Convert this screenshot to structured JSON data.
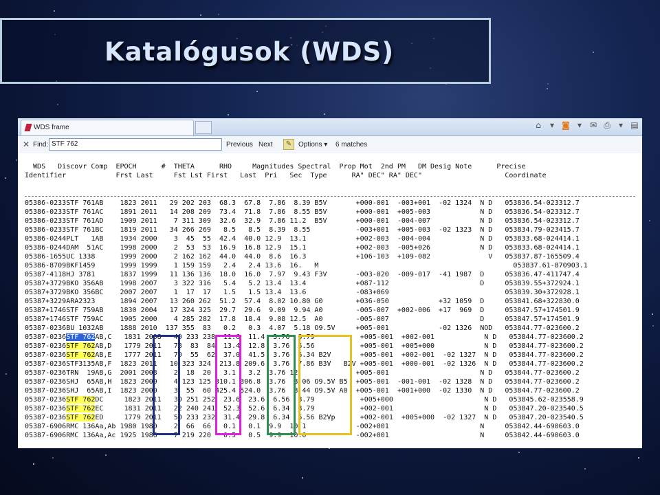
{
  "slide": {
    "title": "Katalógusok (WDS)"
  },
  "window": {
    "tab_title": "WDS frame",
    "find": {
      "close": "✕",
      "label": "Find:",
      "value": "STF 762",
      "previous": "Previous",
      "next": "Next",
      "options": "Options ▾",
      "matches": "6 matches"
    }
  },
  "table": {
    "header_line1": "  WDS   Discovr Comp  EPOCH      #  THETA      RHO     Magnitudes Spectral  Prop Mot  2nd PM   DM Desig Note      Precise",
    "header_line2": "Identifier            Frst Last     Fst Lst First   Last  Pri   Sec  Type      RA\" DEC\" RA\" DEC\"                    Coordinate",
    "rows": [
      {
        "pre": "05386-0233STF 761AB    1823 2011   29 202 203  68.3  67.8  7.86  8.39 B5V       +000-001  -003+001  -02 1324  N D   053836.54-023312.7",
        "hl": "",
        "post": ""
      },
      {
        "pre": "05386-0233STF 761AC    1891 2011   14 208 209  73.4  71.8  7.86  8.55 B5V       +000-001  +005-003            N D   053836.54-023312.7",
        "hl": "",
        "post": ""
      },
      {
        "pre": "05386-0233STF 761AD    1909 2011    7 311 309  32.6  32.9  7.86 11.2  B5V       +000-001  -004-007            N D   053836.54-023312.7",
        "hl": "",
        "post": ""
      },
      {
        "pre": "05386-0233STF 761BC    1819 2011   34 266 269   8.5   8.5  8.39  8.55           -003+001  +005-003  -02 1323  N D   053834.79-023415.7",
        "hl": "",
        "post": ""
      },
      {
        "pre": "05386-0244PLT   1AB    1934 2000    3  45  55  42.4  40.0 12.9  13.1            +002-003  -004-004            N D   053833.68-024414.1",
        "hl": "",
        "post": ""
      },
      {
        "pre": "05386-0244DAM  51AC    1998 2000    2  53  53  16.9  16.8 12.9  15.1            +002-003  -005+026            N D   053833.68-024414.1",
        "hl": "",
        "post": ""
      },
      {
        "pre": "05386-1655UC 1338      1999 2000    2 162 162  44.0  44.0  8.6  16.3            +106-103  +109-082              V   053837.87-165509.4",
        "hl": "",
        "post": ""
      },
      {
        "pre": "05386-8709BKF1459      1999 1999    1 159 159   2.4   2.4 13.6  16.   M                                               053837.61-870903.1",
        "hl": "",
        "post": ""
      },
      {
        "pre": "05387-4118HJ 3781      1837 1999   11 136 136  18.0  16.0  7.97  9.43 F3V       -003-020  -009-017  -41 1987  D     053836.47-411747.4",
        "hl": "",
        "post": ""
      },
      {
        "pre": "05387+3729BKO 356AB    1998 2007    3 322 316   5.4   5.2 13.4  13.4            +087-112                      D     053839.55+372924.1",
        "hl": "",
        "post": ""
      },
      {
        "pre": "05387+3729BKO 356BC    2007 2007    1  17  17   1.5   1.5 13.4  13.6            -083+069                            053839.30+372928.1",
        "hl": "",
        "post": ""
      },
      {
        "pre": "05387+3229ARA2323      1894 2007   13 260 262  51.2  57.4  8.02 10.80 G0        +036-050            +32 1059  D     053841.68+322830.0",
        "hl": "",
        "post": ""
      },
      {
        "pre": "05387+1746STF 759AB    1830 2004   17 324 325  29.7  29.6  9.09  9.94 A0        -005-007  +002-006  +17  969  D     053847.57+174501.9",
        "hl": "",
        "post": ""
      },
      {
        "pre": "05387+1746STF 759AC    1905 2000    4 285 282  17.8  18.4  9.08 12.5  A0        -005-007                      D     053847.57+174501.9",
        "hl": "",
        "post": ""
      },
      {
        "pre": "05387-0236BU 1032AB    1888 2010  137 355  83   0.2   0.3  4.07  5.18 O9.5V     +005-001            -02 1326  NOD   053844.77-023600.2",
        "hl": "",
        "post": ""
      },
      {
        "pre": "05387-0236",
        "hl": "STF 762",
        "hlc": "blue",
        "post": "AB,C   1831 2008   40 233 238  11.6  11.4  3.76  8.79           +005-001  +002-001            N D   053844.77-023600.2"
      },
      {
        "pre": "05387-0236",
        "hl": "STF 762",
        "hlc": "yellow",
        "post": "AB,D   1779 2011   78  83  84  13.4  12.8  3.76  6.56           +005-001  +005+000            N D   053844.77-023600.2"
      },
      {
        "pre": "05387-0236",
        "hl": "STF 762",
        "hlc": "yellow",
        "post": "AB,E   1777 2011   70  55  62  37.0  41.5  3.76  6.34 B2V       +005-001  +002-001  -02 1327  N D   053844.77-023600.2"
      },
      {
        "pre": "05387-0236STF3135AB,F  1823 2011   10 323 324  213.8 209.6  3.76  7.86 B3V   B2V +005-001  +000-001  -02 1326  N D   053844.77-023600.2",
        "hl": "",
        "post": ""
      },
      {
        "pre": "05387-0236TRN  19AB,G  2001 2008    2  18  20   3.1   3.2  3.76 12.             +005-001                      N D   053844.77-023600.2",
        "hl": "",
        "post": ""
      },
      {
        "pre": "05387-0236SHJ  65AB,H  1823 2000    4 123 125 310.1 306.8  3.76  8.06 O9.5V B5  +005-001  -001-001  -02 1328  N D   053844.77-023600.2",
        "hl": "",
        "post": ""
      },
      {
        "pre": "05387-0236SHJ  65AB,I  1823 2000    3  55  60 425.4 524.0  3.76  8.44 O9.5V A0  +005-001  +001+000  -02 1330  N D   053844.77-023600.2",
        "hl": "",
        "post": ""
      },
      {
        "pre": "05387-0236",
        "hl": "STF 762",
        "hlc": "yellow",
        "post": "DC     1823 2011   30 251 252  23.6  23.6  6.56  8.79           +005+000                      N D   053845.62-023558.9"
      },
      {
        "pre": "05387-0236",
        "hl": "STF 762",
        "hlc": "yellow",
        "post": "EC     1831 2011   22 240 241  52.3  52.6  6.34  8.79           +002-001                      N D   053847.20-023540.5"
      },
      {
        "pre": "05387-0236",
        "hl": "STF 762",
        "hlc": "yellow",
        "post": "ED     1779 2011   50 233 232  31.4  29.8  6.34  6.56 B2Vp      +002-001  +005+000  -02 1327  N D   053847.20-023540.5"
      },
      {
        "pre": "05387-6906RMC 136Aa,Ab 1980 1980    2  66  66   0.1   0.1  9.9  10.1            -002+001                      N     053842.44-690603.0",
        "hl": "",
        "post": ""
      },
      {
        "pre": "05387-6906RMC 136Aa,Ac 1925 1986    7 219 220   0.5   0.5  9.9  10.0            -002+001                      N     053842.44-690603.0",
        "hl": "",
        "post": ""
      }
    ]
  },
  "colors": {
    "box_epoch": "#1f2f86",
    "box_theta": "#e020e0",
    "box_rho": "#2f8f4f",
    "box_mag": "#e8c020"
  }
}
